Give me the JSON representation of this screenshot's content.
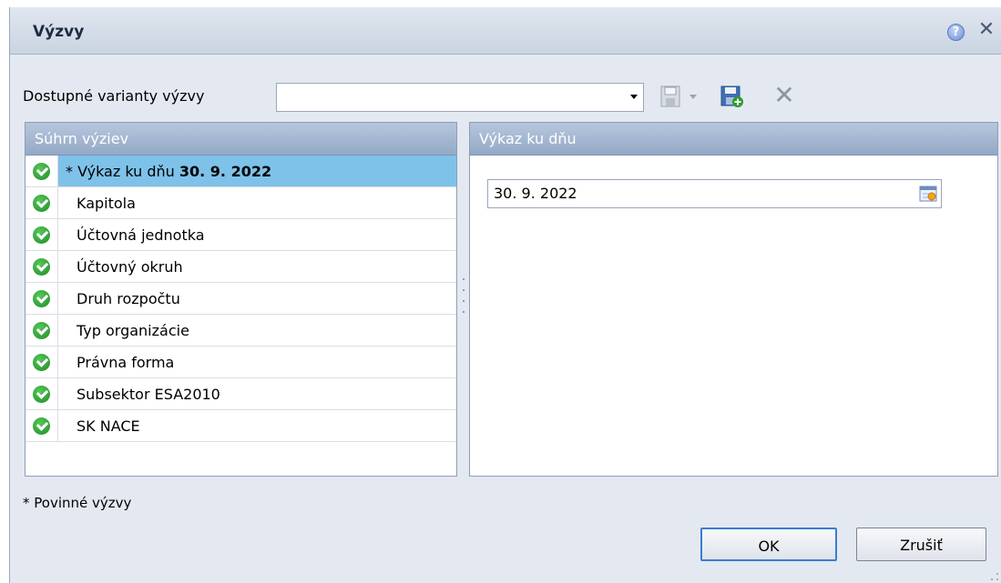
{
  "dialog": {
    "title": "Výzvy",
    "help_icon": "question-circle-icon",
    "close_icon": "close-icon"
  },
  "toolbar": {
    "variant_label": "Dostupné varianty výzvy",
    "variant_value": "",
    "icons": [
      "save-icon",
      "chevron-down-icon",
      "save-as-icon",
      "delete-icon"
    ]
  },
  "left_panel": {
    "header": "Súhrn výziev",
    "items": [
      {
        "prefix": "* Výkaz ku dňu ",
        "value": "30. 9. 2022",
        "selected": true,
        "status": "check-icon"
      },
      {
        "prefix": "Kapitola",
        "value": "",
        "selected": false,
        "status": "check-icon"
      },
      {
        "prefix": "Účtovná jednotka",
        "value": "",
        "selected": false,
        "status": "check-icon"
      },
      {
        "prefix": "Účtovný okruh",
        "value": "",
        "selected": false,
        "status": "check-icon"
      },
      {
        "prefix": "Druh rozpočtu",
        "value": "",
        "selected": false,
        "status": "check-icon"
      },
      {
        "prefix": "Typ organizácie",
        "value": "",
        "selected": false,
        "status": "check-icon"
      },
      {
        "prefix": "Právna forma",
        "value": "",
        "selected": false,
        "status": "check-icon"
      },
      {
        "prefix": "Subsektor ESA2010",
        "value": "",
        "selected": false,
        "status": "check-icon"
      },
      {
        "prefix": "SK NACE",
        "value": "",
        "selected": false,
        "status": "check-icon"
      }
    ]
  },
  "right_panel": {
    "header": "Výkaz ku dňu",
    "date_value": "30. 9. 2022"
  },
  "footer": {
    "required_note": "* Povinné výzvy",
    "ok_label": "OK",
    "cancel_label": "Zrušiť"
  },
  "colors": {
    "selection": "#7ec2ea",
    "panel_header": "#a5b8d3",
    "check": "#2a9a31"
  }
}
